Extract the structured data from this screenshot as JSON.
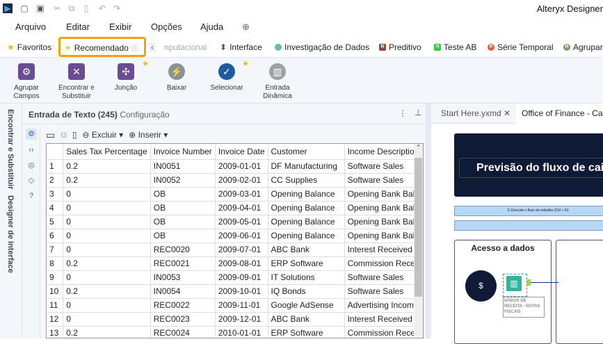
{
  "app": {
    "title": "Alteryx Designer"
  },
  "menu": [
    "Arquivo",
    "Editar",
    "Exibir",
    "Opções",
    "Ajuda"
  ],
  "categories": {
    "favoritos": "Favoritos",
    "recomendado": "Recomendado",
    "computacional": "nputacional",
    "interface": "Interface",
    "investigacao": "Investigação de Dados",
    "preditivo": "Preditivo",
    "teste_ab": "Teste AB",
    "serie_temporal": "Série Temporal",
    "agrupar": "Agrupar"
  },
  "tools": [
    {
      "label": "Agrupar Campos",
      "color": "#6a4c93"
    },
    {
      "label": "Encontrar e Substituir",
      "color": "#6a4c93"
    },
    {
      "label": "Junção",
      "color": "#6a4c93"
    },
    {
      "label": "Baixar",
      "color": "#8a9299"
    },
    {
      "label": "Selecionar",
      "color": "#1e5aa0"
    },
    {
      "label": "Entrada Dinâmica",
      "color": "#9aa0a6"
    }
  ],
  "side_tabs": [
    "Encontrar e Substituir",
    "Designer de Interface"
  ],
  "config": {
    "title": "Entrada de Texto (245)",
    "subtitle": "- Configuração",
    "delete": "Excluir",
    "insert": "Inserir"
  },
  "table": {
    "columns": [
      "",
      "Sales Tax Percentage",
      "Invoice Number",
      "Invoice Date",
      "Customer",
      "Income Description"
    ],
    "rows": [
      [
        "1",
        "0.2",
        "IN0051",
        "2009-01-01",
        "DF Manufacturing",
        "Software Sales"
      ],
      [
        "2",
        "0.2",
        "IN0052",
        "2009-02-01",
        "CC Supplies",
        "Software Sales"
      ],
      [
        "3",
        "0",
        "OB",
        "2009-03-01",
        "Opening Balance",
        "Opening Bank Bala"
      ],
      [
        "4",
        "0",
        "OB",
        "2009-04-01",
        "Opening Balance",
        "Opening Bank Bala"
      ],
      [
        "5",
        "0",
        "OB",
        "2009-05-01",
        "Opening Balance",
        "Opening Bank Bala"
      ],
      [
        "6",
        "0",
        "OB",
        "2009-06-01",
        "Opening Balance",
        "Opening Bank Bala"
      ],
      [
        "7",
        "0",
        "REC0020",
        "2009-07-01",
        "ABC Bank",
        "Interest Received"
      ],
      [
        "8",
        "0.2",
        "REC0021",
        "2009-08-01",
        "ERP Software",
        "Commission Recei"
      ],
      [
        "9",
        "0",
        "IN0053",
        "2009-09-01",
        "IT Solutions",
        "Software Sales"
      ],
      [
        "10",
        "0.2",
        "IN0054",
        "2009-10-01",
        "IQ Bonds",
        "Software Sales"
      ],
      [
        "11",
        "0",
        "REC0022",
        "2009-11-01",
        "Google AdSense",
        "Advertising Income"
      ],
      [
        "12",
        "0",
        "REC0023",
        "2009-12-01",
        "ABC Bank",
        "Interest Received"
      ],
      [
        "13",
        "0.2",
        "REC0024",
        "2010-01-01",
        "ERP Software",
        "Commission Recei"
      ]
    ]
  },
  "tabs": [
    "Start Here.yxmd",
    "Office of Finance - Cas"
  ],
  "canvas": {
    "banner": "Previsão do fluxo de cai",
    "step1": "1) Execute o fluxo de trabalho (Ctrl + R).",
    "section": "Acesso a dados",
    "tool_label": "DADOS DE RECEITA - NOTAS FISCAIS"
  }
}
